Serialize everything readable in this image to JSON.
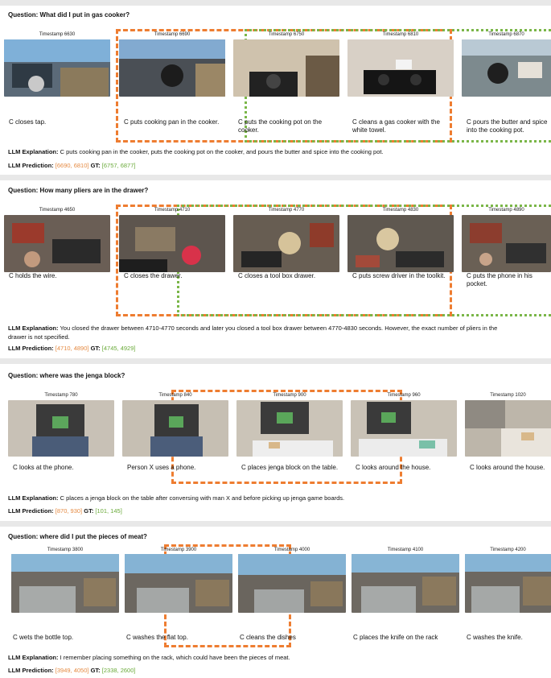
{
  "sections": [
    {
      "question": "Question: What did I put in gas cooker?",
      "frames": [
        {
          "timestamp": "Timestamp 6630",
          "caption": "C closes tap."
        },
        {
          "timestamp": "Timestamp 6690",
          "caption": "C puts cooking pan in the cooker."
        },
        {
          "timestamp": "Timestamp 6750",
          "caption": "C puts the cooking pot on the cooker."
        },
        {
          "timestamp": "Timestamp 6810",
          "caption": "C cleans a gas cooker with the white towel."
        },
        {
          "timestamp": "Timestamp 6870",
          "caption": "C pours the butter and spice into the cooking pot."
        }
      ],
      "explanation_label": "LLM Explanation:",
      "explanation": "C puts cooking pan in the cooker, puts the cooking pot on the cooker, and pours the butter and spice into the cooking pot.",
      "prediction_label": "LLM Prediction:",
      "prediction": "[6690, 6810]",
      "gt_label": "GT:",
      "gt": "[6757, 6877]"
    },
    {
      "question": "Question: How many pliers are in the drawer?",
      "frames": [
        {
          "timestamp": "Timestamp 4650",
          "caption": "C holds the wire."
        },
        {
          "timestamp": "Timestamp 4710",
          "caption": "C closes the drawer."
        },
        {
          "timestamp": "Timestamp 4770",
          "caption": "C closes a tool box drawer."
        },
        {
          "timestamp": "Timestamp 4830",
          "caption": "C puts screw driver in the toolkit."
        },
        {
          "timestamp": "Timestamp 4890",
          "caption": "C puts the phone in his pocket."
        }
      ],
      "explanation_label": "LLM Explanation:",
      "explanation": "You closed the drawer between 4710-4770 seconds and later you closed a tool box drawer between 4770-4830 seconds. However, the exact number of pliers in the",
      "explanation_cont": "drawer is not specified.",
      "prediction_label": "LLM Prediction:",
      "prediction": "[4710, 4890]",
      "gt_label": "GT:",
      "gt": "[4745, 4929]"
    },
    {
      "question": "Question: where was the jenga block?",
      "frames": [
        {
          "timestamp": "Timestamp 780",
          "caption": "C looks at the phone."
        },
        {
          "timestamp": "Timestamp 840",
          "caption": "Person X uses a phone."
        },
        {
          "timestamp": "Timestamp 900",
          "caption": "C places jenga block on the table."
        },
        {
          "timestamp": "Timestamp 960",
          "caption": "C looks around the house."
        },
        {
          "timestamp": "Timestamp 1020",
          "caption": "C looks around the house."
        }
      ],
      "explanation_label": "LLM Explanation:",
      "explanation": "C places a jenga block on the table after conversing with man X and before picking up jenga game boards.",
      "prediction_label": "LLM Prediction:",
      "prediction": "[870, 930]",
      "gt_label": "GT:",
      "gt": "[101, 145]"
    },
    {
      "question": "Question: where did I put the pieces of meat?",
      "frames": [
        {
          "timestamp": "Timestamp 3800",
          "caption": "C wets the bottle top."
        },
        {
          "timestamp": "Timestamp 3900",
          "caption": "C washes the flat top."
        },
        {
          "timestamp": "Timestamp 4000",
          "caption": "C cleans the dishes"
        },
        {
          "timestamp": "Timestamp 4100",
          "caption": "C places the knife on the rack"
        },
        {
          "timestamp": "Timestamp 4200",
          "caption": "C washes the knife."
        }
      ],
      "explanation_label": "LLM Explanation:",
      "explanation": "I remember placing something on the rack, which could have been the pieces of meat.",
      "prediction_label": "LLM Prediction:",
      "prediction": "[3949, 4050]",
      "gt_label": "GT:",
      "gt": "[2338, 2600]"
    }
  ],
  "colors": {
    "prediction": "#ee7d31",
    "ground_truth": "#7ab648",
    "overlap": "#a9922c",
    "separator": "#e8e8e8"
  }
}
